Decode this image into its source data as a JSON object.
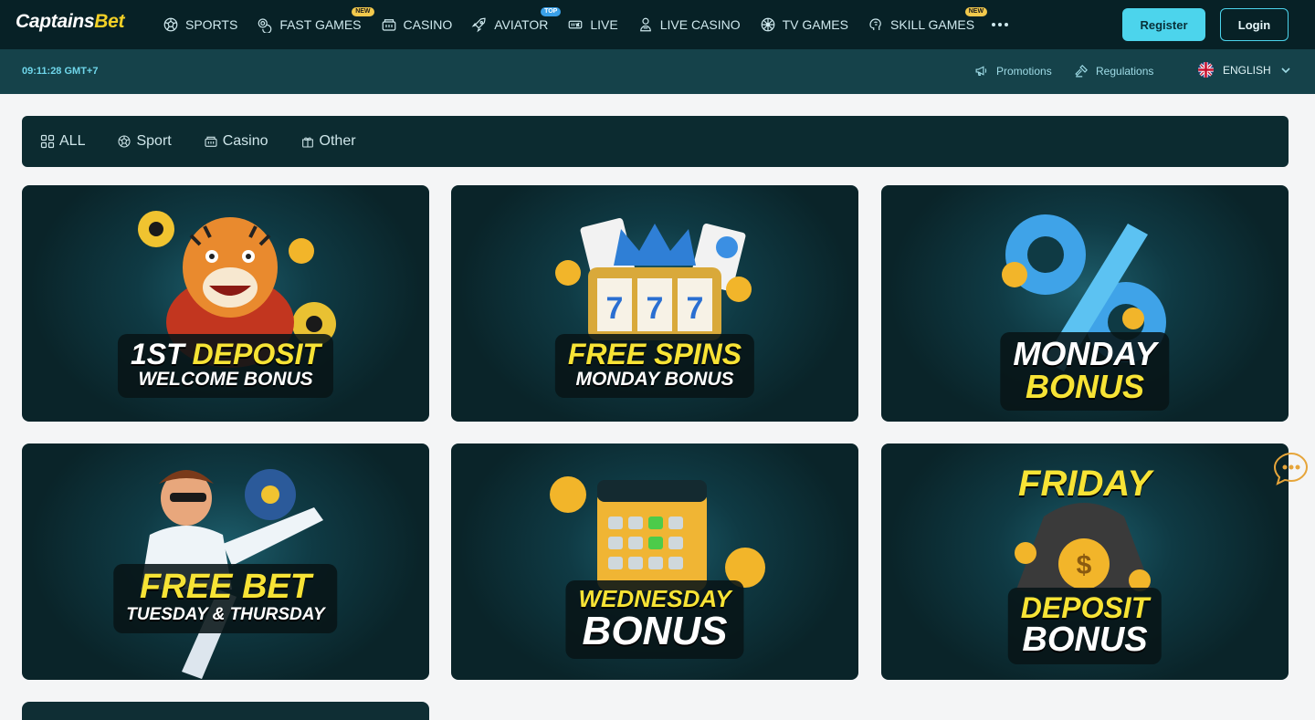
{
  "brand": {
    "logo_part1": "Captains",
    "logo_part2": "Bet"
  },
  "nav": {
    "items": [
      {
        "label": "SPORTS",
        "icon": "soccer-ball-icon",
        "badge": ""
      },
      {
        "label": "FAST GAMES",
        "icon": "chips-icon",
        "badge": "NEW"
      },
      {
        "label": "CASINO",
        "icon": "slot-machine-icon",
        "badge": ""
      },
      {
        "label": "AVIATOR",
        "icon": "rocket-icon",
        "badge": "TOP"
      },
      {
        "label": "LIVE",
        "icon": "live-ticket-icon",
        "badge": ""
      },
      {
        "label": "LIVE CASINO",
        "icon": "dealer-icon",
        "badge": ""
      },
      {
        "label": "TV GAMES",
        "icon": "wheel-icon",
        "badge": ""
      },
      {
        "label": "SKILL GAMES",
        "icon": "brain-icon",
        "badge": "NEW"
      }
    ]
  },
  "auth": {
    "register": "Register",
    "login": "Login"
  },
  "subbar": {
    "clock": "09:11:28 GMT+7",
    "promotions": "Promotions",
    "regulations": "Regulations",
    "language": "ENGLISH"
  },
  "filters": [
    {
      "label": "ALL",
      "icon": "grid-icon"
    },
    {
      "label": "Sport",
      "icon": "soccer-ball-icon"
    },
    {
      "label": "Casino",
      "icon": "slot-machine-icon"
    },
    {
      "label": "Other",
      "icon": "gift-icon"
    }
  ],
  "promos": [
    {
      "line1a": "1ST",
      "line1b": "DEPOSIT",
      "line2": "WELCOME BONUS"
    },
    {
      "line1": "FREE SPINS",
      "line2": "MONDAY BONUS"
    },
    {
      "line1": "MONDAY",
      "line2": "BONUS"
    },
    {
      "line1": "FREE BET",
      "line2": "TUESDAY & THURSDAY"
    },
    {
      "line1": "WEDNESDAY",
      "line2": "BONUS"
    },
    {
      "line0": "FRIDAY",
      "line1": "DEPOSIT",
      "line2": "BONUS"
    }
  ],
  "colors": {
    "accent": "#4cd4ec",
    "yellow": "#f7e335",
    "nav_bg": "#072126",
    "subbar_bg": "#15424a",
    "page_bg": "#f4f5f6"
  }
}
